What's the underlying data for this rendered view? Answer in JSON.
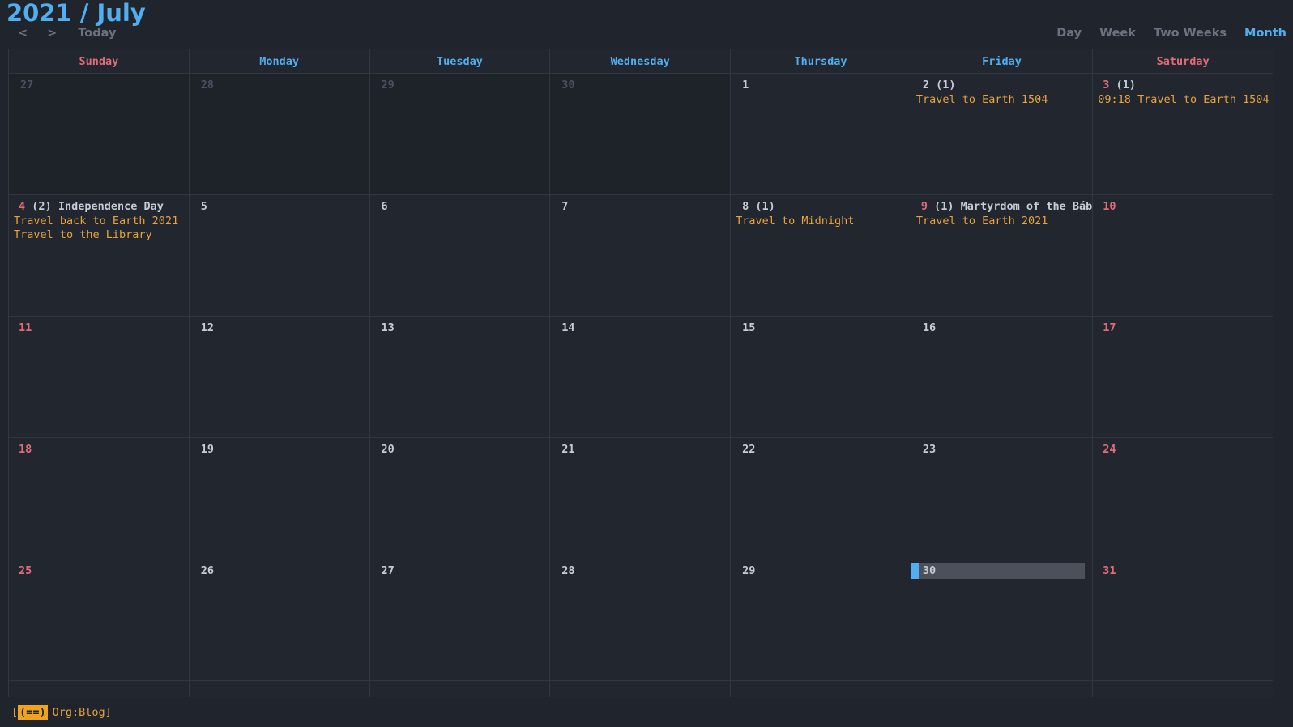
{
  "header": {
    "title": "2021 / July",
    "nav": {
      "prev": "<",
      "next": ">",
      "today": "Today"
    },
    "views": [
      {
        "label": "Day",
        "active": false
      },
      {
        "label": "Week",
        "active": false
      },
      {
        "label": "Two Weeks",
        "active": false
      },
      {
        "label": "Month",
        "active": true
      }
    ]
  },
  "colors": {
    "background": "#20242c",
    "cell": "#22262f",
    "cell_other_month": "#1e2229",
    "border": "#32363f",
    "accent_blue": "#51afef",
    "weekend_red": "#e06c75",
    "event_orange": "#e8a33d",
    "dim_gray": "#4b5160",
    "text": "#c6ccd6",
    "selection": "#4c505a",
    "status_mode_bg": "#f0a31e"
  },
  "day_headers": [
    {
      "label": "Sunday",
      "weekend": true
    },
    {
      "label": "Monday",
      "weekend": false
    },
    {
      "label": "Tuesday",
      "weekend": false
    },
    {
      "label": "Wednesday",
      "weekend": false
    },
    {
      "label": "Thursday",
      "weekend": false
    },
    {
      "label": "Friday",
      "weekend": false
    },
    {
      "label": "Saturday",
      "weekend": true
    }
  ],
  "weeks": [
    [
      {
        "day": "27",
        "style": "dim",
        "other_month": true,
        "count": "",
        "holiday": "",
        "events": []
      },
      {
        "day": "28",
        "style": "dim",
        "other_month": true,
        "count": "",
        "holiday": "",
        "events": []
      },
      {
        "day": "29",
        "style": "dim",
        "other_month": true,
        "count": "",
        "holiday": "",
        "events": []
      },
      {
        "day": "30",
        "style": "dim",
        "other_month": true,
        "count": "",
        "holiday": "",
        "events": []
      },
      {
        "day": "1",
        "style": "normal",
        "other_month": false,
        "count": "",
        "holiday": "",
        "events": []
      },
      {
        "day": "2",
        "style": "normal",
        "other_month": false,
        "count": "(1)",
        "holiday": "",
        "events": [
          "Travel to Earth 1504"
        ]
      },
      {
        "day": "3",
        "style": "red",
        "other_month": false,
        "count": "(1)",
        "holiday": "",
        "events": [
          "09:18 Travel to Earth 1504"
        ]
      }
    ],
    [
      {
        "day": "4",
        "style": "red",
        "other_month": false,
        "count": "(2)",
        "holiday": "Independence Day",
        "events": [
          "Travel back to Earth 2021",
          "Travel to the Library"
        ]
      },
      {
        "day": "5",
        "style": "normal",
        "other_month": false,
        "count": "",
        "holiday": "",
        "events": []
      },
      {
        "day": "6",
        "style": "normal",
        "other_month": false,
        "count": "",
        "holiday": "",
        "events": []
      },
      {
        "day": "7",
        "style": "normal",
        "other_month": false,
        "count": "",
        "holiday": "",
        "events": []
      },
      {
        "day": "8",
        "style": "normal",
        "other_month": false,
        "count": "(1)",
        "holiday": "",
        "events": [
          "Travel to Midnight"
        ]
      },
      {
        "day": "9",
        "style": "red",
        "other_month": false,
        "count": "(1)",
        "holiday": "Martyrdom of the Báb",
        "events": [
          "Travel to Earth 2021"
        ]
      },
      {
        "day": "10",
        "style": "red",
        "other_month": false,
        "count": "",
        "holiday": "",
        "events": []
      }
    ],
    [
      {
        "day": "11",
        "style": "red",
        "other_month": false,
        "count": "",
        "holiday": "",
        "events": []
      },
      {
        "day": "12",
        "style": "normal",
        "other_month": false,
        "count": "",
        "holiday": "",
        "events": []
      },
      {
        "day": "13",
        "style": "normal",
        "other_month": false,
        "count": "",
        "holiday": "",
        "events": []
      },
      {
        "day": "14",
        "style": "normal",
        "other_month": false,
        "count": "",
        "holiday": "",
        "events": []
      },
      {
        "day": "15",
        "style": "normal",
        "other_month": false,
        "count": "",
        "holiday": "",
        "events": []
      },
      {
        "day": "16",
        "style": "normal",
        "other_month": false,
        "count": "",
        "holiday": "",
        "events": []
      },
      {
        "day": "17",
        "style": "red",
        "other_month": false,
        "count": "",
        "holiday": "",
        "events": []
      }
    ],
    [
      {
        "day": "18",
        "style": "red",
        "other_month": false,
        "count": "",
        "holiday": "",
        "events": []
      },
      {
        "day": "19",
        "style": "normal",
        "other_month": false,
        "count": "",
        "holiday": "",
        "events": []
      },
      {
        "day": "20",
        "style": "normal",
        "other_month": false,
        "count": "",
        "holiday": "",
        "events": []
      },
      {
        "day": "21",
        "style": "normal",
        "other_month": false,
        "count": "",
        "holiday": "",
        "events": []
      },
      {
        "day": "22",
        "style": "normal",
        "other_month": false,
        "count": "",
        "holiday": "",
        "events": []
      },
      {
        "day": "23",
        "style": "normal",
        "other_month": false,
        "count": "",
        "holiday": "",
        "events": []
      },
      {
        "day": "24",
        "style": "red",
        "other_month": false,
        "count": "",
        "holiday": "",
        "events": []
      }
    ],
    [
      {
        "day": "25",
        "style": "red",
        "other_month": false,
        "count": "",
        "holiday": "",
        "events": []
      },
      {
        "day": "26",
        "style": "normal",
        "other_month": false,
        "count": "",
        "holiday": "",
        "events": []
      },
      {
        "day": "27",
        "style": "normal",
        "other_month": false,
        "count": "",
        "holiday": "",
        "events": []
      },
      {
        "day": "28",
        "style": "normal",
        "other_month": false,
        "count": "",
        "holiday": "",
        "events": []
      },
      {
        "day": "29",
        "style": "normal",
        "other_month": false,
        "count": "",
        "holiday": "",
        "events": []
      },
      {
        "day": "30",
        "style": "normal",
        "other_month": false,
        "count": "",
        "holiday": "",
        "events": [],
        "selected": true
      },
      {
        "day": "31",
        "style": "red",
        "other_month": false,
        "count": "",
        "holiday": "",
        "events": []
      }
    ],
    [
      {
        "day": "",
        "style": "normal",
        "other_month": false,
        "count": "",
        "holiday": "",
        "events": []
      },
      {
        "day": "",
        "style": "normal",
        "other_month": false,
        "count": "",
        "holiday": "",
        "events": []
      },
      {
        "day": "",
        "style": "normal",
        "other_month": false,
        "count": "",
        "holiday": "",
        "events": []
      },
      {
        "day": "",
        "style": "normal",
        "other_month": false,
        "count": "",
        "holiday": "",
        "events": []
      },
      {
        "day": "",
        "style": "normal",
        "other_month": false,
        "count": "",
        "holiday": "",
        "events": []
      },
      {
        "day": "",
        "style": "normal",
        "other_month": false,
        "count": "",
        "holiday": "",
        "events": []
      },
      {
        "day": "",
        "style": "normal",
        "other_month": false,
        "count": "",
        "holiday": "",
        "events": []
      }
    ]
  ],
  "statusbar": {
    "open_bracket": "[",
    "mode": "(==)",
    "text": "Org:Blog]"
  }
}
